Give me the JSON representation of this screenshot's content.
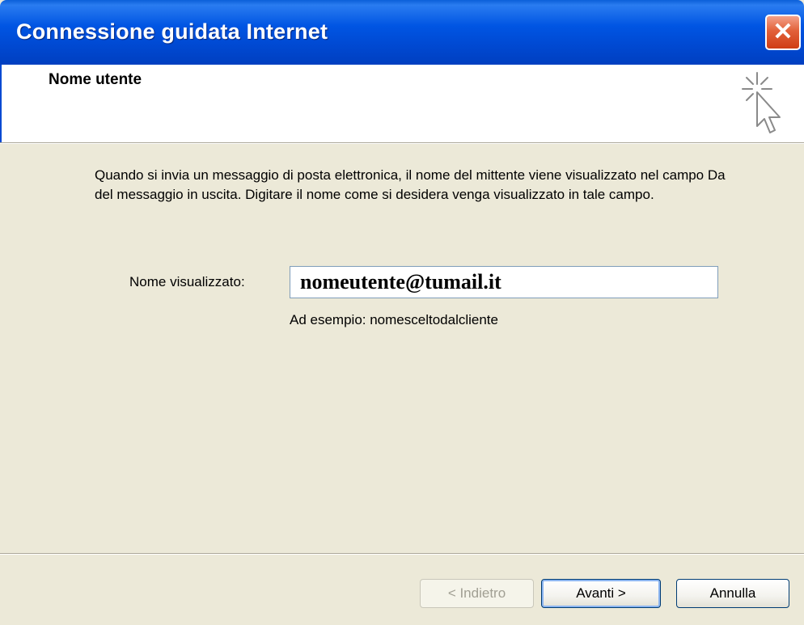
{
  "window": {
    "title": "Connessione guidata Internet",
    "close_symbol": "✕"
  },
  "header": {
    "title": "Nome utente",
    "icon": "wizard-cursor-icon"
  },
  "body": {
    "intro_text": "Quando si invia un messaggio di posta elettronica, il nome del mittente viene visualizzato nel campo Da del messaggio in uscita. Digitare il nome come si desidera venga visualizzato in tale campo.",
    "field_label": "Nome visualizzato:",
    "field_value": "nomeutente@tumail.it",
    "example_text": "Ad esempio: nomesceltodalcliente"
  },
  "buttons": {
    "back_label": "< Indietro",
    "next_label": "Avanti >",
    "cancel_label": "Annulla"
  },
  "colors": {
    "titlebar": "#0055e3",
    "dialog_bg": "#ece9d8",
    "close_button": "#e2613a"
  }
}
